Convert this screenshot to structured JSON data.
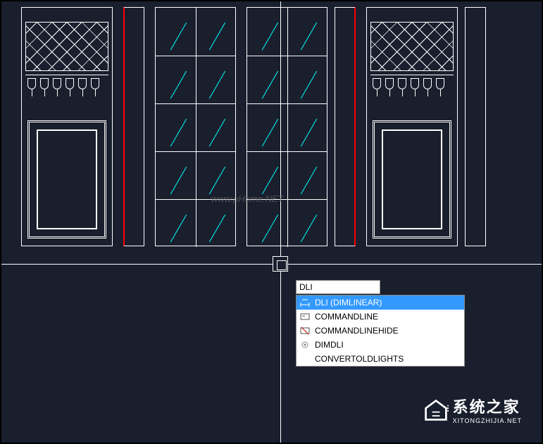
{
  "command_input": {
    "value": "DLI"
  },
  "autocomplete": {
    "items": [
      {
        "label": "DLI (DIMLINEAR)",
        "icon": "dim-linear-icon",
        "selected": true
      },
      {
        "label": "COMMANDLINE",
        "icon": "commandline-icon",
        "selected": false
      },
      {
        "label": "COMMANDLINEHIDE",
        "icon": "commandline-hide-icon",
        "selected": false
      },
      {
        "label": "DIMDLI",
        "icon": "gear-icon",
        "selected": false
      },
      {
        "label": "CONVERTOLDLIGHTS",
        "icon": "",
        "selected": false
      }
    ]
  },
  "watermarks": {
    "center": "www.pHome.NET",
    "logo_cn": "系统之家",
    "logo_en": "XITONGZHIJIA.NET"
  },
  "colors": {
    "background": "#1a1f2e",
    "crosshair": "#ffffff",
    "glass_hatch": "#00ffff",
    "accent_line": "#ff0000",
    "selection": "#3399ff"
  }
}
